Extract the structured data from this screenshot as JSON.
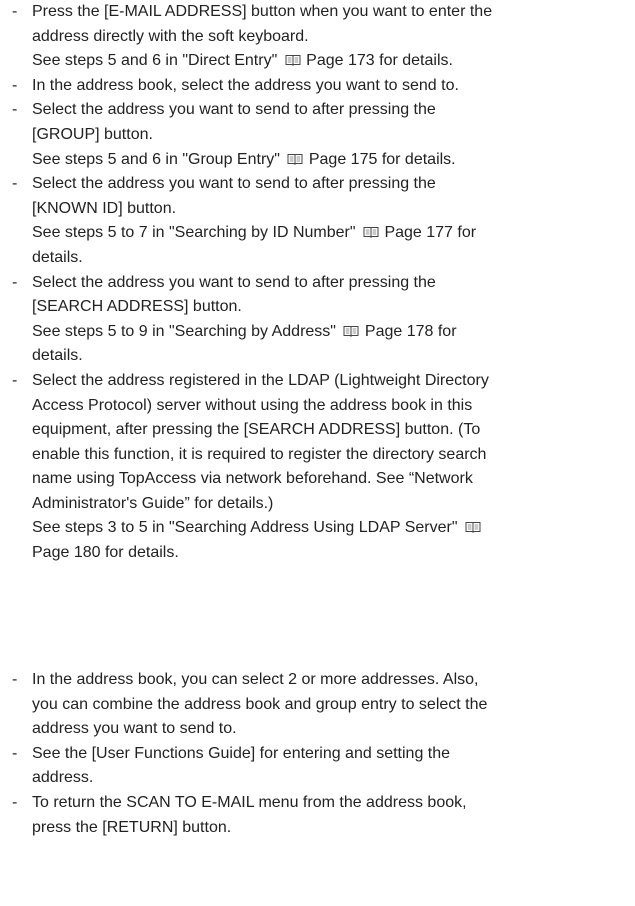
{
  "list1": [
    {
      "lines": [
        "Press the [E-MAIL ADDRESS] button when you want to enter the",
        "address directly with the soft keyboard."
      ],
      "ref_before": "See steps 5 and 6 in \"Direct Entry\"",
      "ref_after": "Page 173 for details."
    },
    {
      "lines": [
        "In the address book, select the address you want to send to."
      ]
    },
    {
      "lines": [
        "Select the address you want to send to after pressing the",
        "[GROUP] button."
      ],
      "ref_before": "See steps 5 and 6 in \"Group Entry\"",
      "ref_after": "Page 175 for details."
    },
    {
      "lines": [
        "Select the address you want to send to after pressing the",
        "[KNOWN ID] button."
      ],
      "ref_before": "See steps 5 to 7 in \"Searching by ID Number\"",
      "ref_after": "Page 177 for",
      "ref_cont": "details."
    },
    {
      "lines": [
        "Select the address you want to send to after pressing the",
        "[SEARCH ADDRESS] button."
      ],
      "ref_before": "See steps 5 to 9 in \"Searching by Address\"",
      "ref_after": "Page 178 for",
      "ref_cont": "details."
    },
    {
      "lines": [
        "Select the address registered in the LDAP (Lightweight Directory",
        "Access Protocol) server without using the address book in this",
        "equipment, after pressing the [SEARCH ADDRESS] button. (To",
        "enable this function, it is required to register the directory search",
        "name using TopAccess via network beforehand. See “Network",
        "Administrator's Guide” for details.)"
      ],
      "ref_before": "See steps 3 to 5 in \"Searching Address Using LDAP Server\"",
      "ref_after": "",
      "ref_cont": "Page 180 for details."
    }
  ],
  "list2": [
    {
      "lines": [
        "In the address book, you can select 2 or more addresses. Also,",
        "you can combine the address book and group entry to select the",
        "address you want to send to."
      ]
    },
    {
      "lines": [
        "See the [User Functions Guide] for entering and setting the",
        "address."
      ]
    },
    {
      "lines": [
        "To return the SCAN TO E-MAIL menu from the address book,",
        "press the [RETURN] button."
      ]
    }
  ]
}
